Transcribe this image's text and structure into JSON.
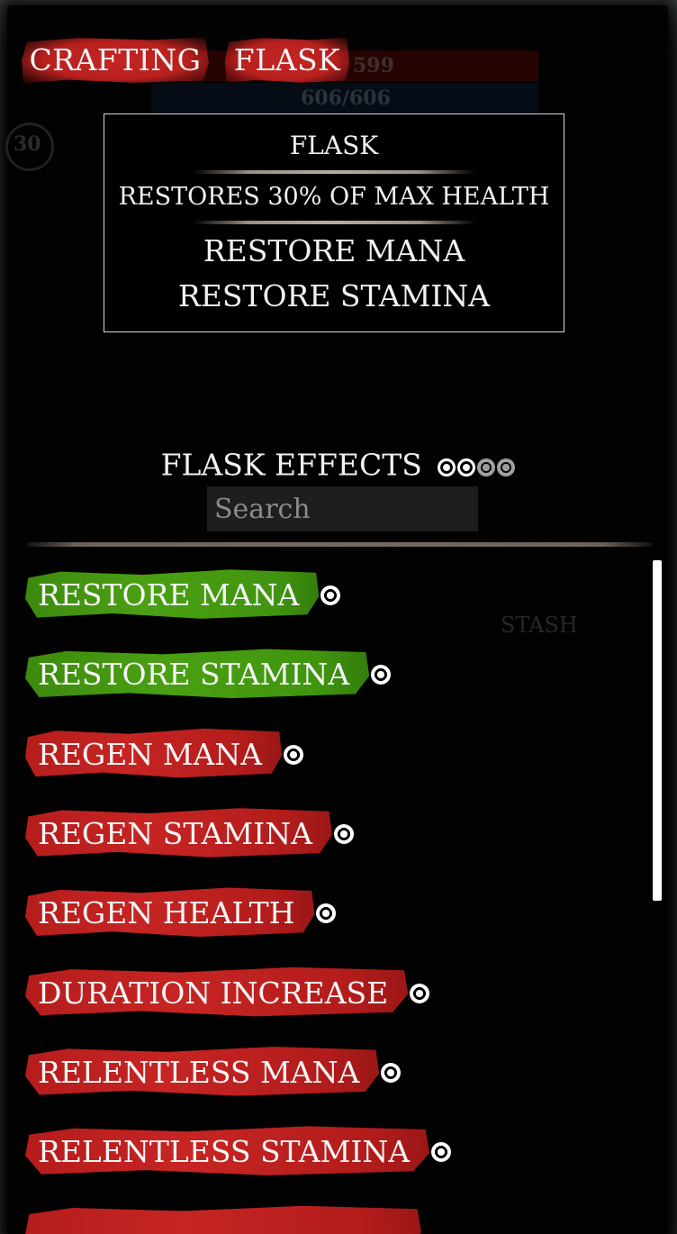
{
  "tabs": [
    {
      "label": "CRAFTING"
    },
    {
      "label": "FLASK"
    }
  ],
  "background_hud": {
    "health": "599",
    "mana": "606/606",
    "level": "30",
    "stash": "STASH"
  },
  "tooltip": {
    "title": "FLASK",
    "description": "RESTORES 30% OF MAX HEALTH",
    "effects": [
      "RESTORE MANA",
      "RESTORE STAMINA"
    ]
  },
  "effects_panel": {
    "title": "FLASK EFFECTS",
    "slots_filled": 2,
    "slots_total": 4,
    "search_placeholder": "Search"
  },
  "effects": [
    {
      "label": "RESTORE MANA",
      "state": "selected",
      "color": "#4aa012"
    },
    {
      "label": "RESTORE STAMINA",
      "state": "selected",
      "color": "#4aa012"
    },
    {
      "label": "REGEN MANA",
      "state": "available",
      "color": "#c62523"
    },
    {
      "label": "REGEN STAMINA",
      "state": "available",
      "color": "#c62523"
    },
    {
      "label": "REGEN HEALTH",
      "state": "available",
      "color": "#c62523"
    },
    {
      "label": "DURATION INCREASE",
      "state": "available",
      "color": "#c62523"
    },
    {
      "label": "RELENTLESS MANA",
      "state": "available",
      "color": "#c62523"
    },
    {
      "label": "RELENTLESS STAMINA",
      "state": "available",
      "color": "#c62523"
    },
    {
      "label": "",
      "state": "available",
      "color": "#c62523"
    }
  ]
}
